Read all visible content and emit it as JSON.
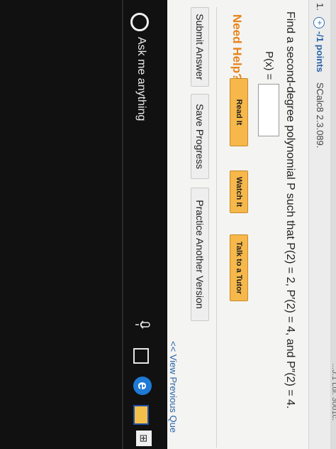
{
  "header": {
    "question_number": "1.",
    "plus_symbol": "+",
    "points": "-/1 points",
    "source": "SCalc8 2.3.089."
  },
  "top_strip_text": "...J.1 Lui. 30o1c.",
  "problem": {
    "statement": "Find a second-degree polynomial P such that P(2) = 2, P′(2) = 4, and P″(2) = 4.",
    "answer_label": "P(x) ="
  },
  "help": {
    "label": "Need Help?",
    "buttons": [
      "Read It",
      "Watch It",
      "Talk to a Tutor"
    ]
  },
  "actions": {
    "submit": "Submit Answer",
    "save": "Save Progress",
    "practice": "Practice Another Version"
  },
  "nav_link": "<< View Previous Que",
  "taskbar": {
    "search_text": "Ask me anything",
    "edge_letter": "e",
    "store_glyph": "⊞"
  }
}
